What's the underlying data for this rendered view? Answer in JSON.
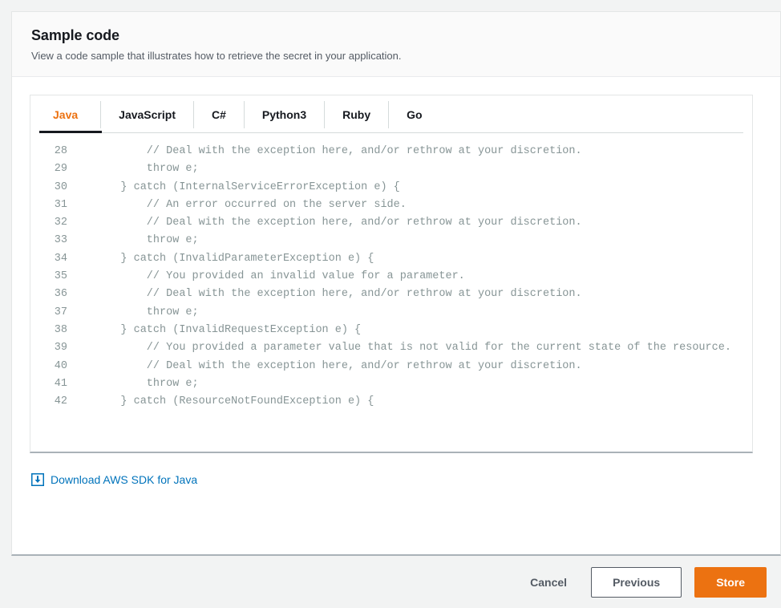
{
  "header": {
    "title": "Sample code",
    "subtitle": "View a code sample that illustrates how to retrieve the secret in your application."
  },
  "tabs": {
    "active": "Java",
    "items": [
      {
        "label": "Java"
      },
      {
        "label": "JavaScript"
      },
      {
        "label": "C#"
      },
      {
        "label": "Python3"
      },
      {
        "label": "Ruby"
      },
      {
        "label": "Go"
      }
    ]
  },
  "code": {
    "language": "Java",
    "lines": [
      {
        "no": "28",
        "text": "        // Deal with the exception here, and/or rethrow at your discretion."
      },
      {
        "no": "29",
        "text": "        throw e;"
      },
      {
        "no": "30",
        "text": "    } catch (InternalServiceErrorException e) {"
      },
      {
        "no": "31",
        "text": "        // An error occurred on the server side."
      },
      {
        "no": "32",
        "text": "        // Deal with the exception here, and/or rethrow at your discretion."
      },
      {
        "no": "33",
        "text": "        throw e;"
      },
      {
        "no": "34",
        "text": "    } catch (InvalidParameterException e) {"
      },
      {
        "no": "35",
        "text": "        // You provided an invalid value for a parameter."
      },
      {
        "no": "36",
        "text": "        // Deal with the exception here, and/or rethrow at your discretion."
      },
      {
        "no": "37",
        "text": "        throw e;"
      },
      {
        "no": "38",
        "text": "    } catch (InvalidRequestException e) {"
      },
      {
        "no": "39",
        "text": "        // You provided a parameter value that is not valid for the current state of the resource."
      },
      {
        "no": "40",
        "text": "        // Deal with the exception here, and/or rethrow at your discretion."
      },
      {
        "no": "41",
        "text": "        throw e;"
      },
      {
        "no": "42",
        "text": "    } catch (ResourceNotFoundException e) {"
      }
    ]
  },
  "download": {
    "icon": "download-icon",
    "label": "Download AWS SDK for Java"
  },
  "footer": {
    "cancel_label": "Cancel",
    "previous_label": "Previous",
    "store_label": "Store"
  },
  "colors": {
    "accent_orange": "#ec7211",
    "link_blue": "#0073bb",
    "text_dark": "#16191f",
    "text_muted": "#545b64",
    "code_gray": "#879596",
    "page_bg": "#f2f3f3"
  }
}
